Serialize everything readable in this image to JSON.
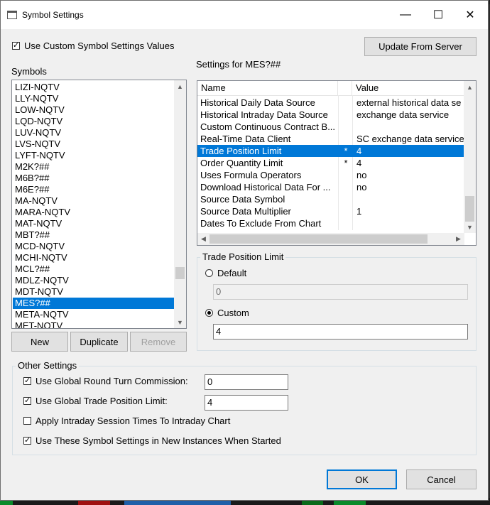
{
  "window": {
    "title": "Symbol Settings"
  },
  "titlebar_buttons": {
    "minimize": "—",
    "maximize": "☐",
    "close": "✕"
  },
  "use_custom": {
    "label": "Use Custom Symbol Settings Values",
    "checked": true
  },
  "update_button": "Update From Server",
  "symbols": {
    "label": "Symbols",
    "items": [
      "LIZI-NQTV",
      "LLY-NQTV",
      "LOW-NQTV",
      "LQD-NQTV",
      "LUV-NQTV",
      "LVS-NQTV",
      "LYFT-NQTV",
      "M2K?##",
      "M6B?##",
      "M6E?##",
      "MA-NQTV",
      "MARA-NQTV",
      "MAT-NQTV",
      "MBT?##",
      "MCD-NQTV",
      "MCHI-NQTV",
      "MCL?##",
      "MDLZ-NQTV",
      "MDT-NQTV",
      "MES?##",
      "META-NQTV",
      "MET-NQTV"
    ],
    "selected": "MES?##"
  },
  "list_buttons": {
    "new": "New",
    "duplicate": "Duplicate",
    "remove": "Remove"
  },
  "settings": {
    "label": "Settings for MES?##",
    "columns": {
      "name": "Name",
      "value": "Value"
    },
    "rows": [
      {
        "name": "Historical Daily Data Source",
        "mark": "",
        "value": "external historical data se"
      },
      {
        "name": "Historical Intraday Data Source",
        "mark": "",
        "value": "exchange data service"
      },
      {
        "name": "Custom Continuous Contract B...",
        "mark": "",
        "value": ""
      },
      {
        "name": "Real-Time Data Client",
        "mark": "",
        "value": "SC exchange data service"
      },
      {
        "name": "Trade Position Limit",
        "mark": "*",
        "value": "4"
      },
      {
        "name": "Order Quantity Limit",
        "mark": "*",
        "value": "4"
      },
      {
        "name": "Uses Formula Operators",
        "mark": "",
        "value": "no"
      },
      {
        "name": "Download Historical Data For ...",
        "mark": "",
        "value": "no"
      },
      {
        "name": "Source Data Symbol",
        "mark": "",
        "value": ""
      },
      {
        "name": "Source Data Multiplier",
        "mark": "",
        "value": "1"
      },
      {
        "name": "Dates To Exclude From Chart",
        "mark": "",
        "value": ""
      }
    ],
    "selected_row": "Trade Position Limit"
  },
  "trade_limit": {
    "legend": "Trade Position Limit",
    "default_label": "Default",
    "default_value": "0",
    "custom_label": "Custom",
    "custom_value": "4",
    "selected": "Custom"
  },
  "other": {
    "legend": "Other Settings",
    "round_turn": {
      "label": "Use Global Round Turn Commission:",
      "checked": true,
      "value": "0"
    },
    "trade_position": {
      "label": "Use Global Trade Position Limit:",
      "checked": true,
      "value": "4"
    },
    "session_times": {
      "label": "Apply Intraday Session Times To Intraday Chart",
      "checked": false
    },
    "new_instances": {
      "label": "Use These Symbol Settings in New Instances When Started",
      "checked": true
    }
  },
  "footer": {
    "ok": "OK",
    "cancel": "Cancel"
  },
  "colors": {
    "selection": "#0078d7",
    "dialog_bg": "#f0f0f0"
  }
}
